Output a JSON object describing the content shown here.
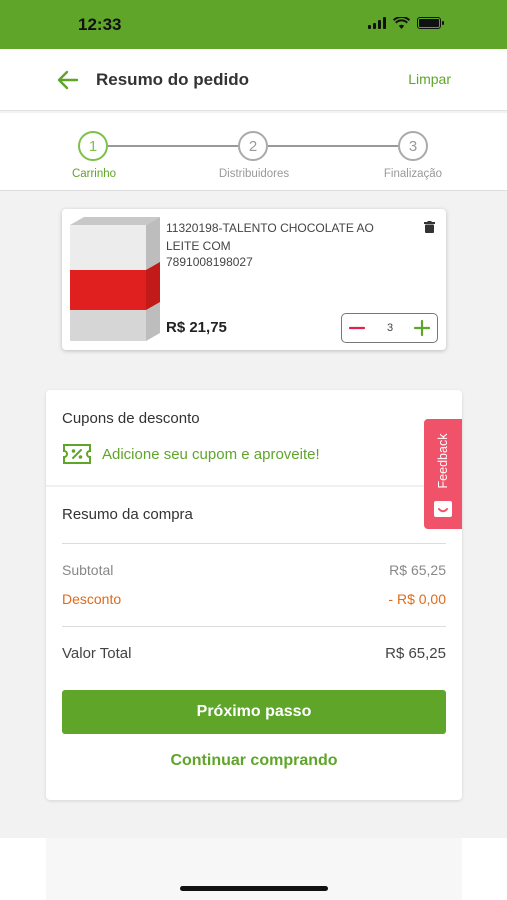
{
  "status_bar": {
    "time": "12:33"
  },
  "header": {
    "title": "Resumo do pedido",
    "clear_label": "Limpar"
  },
  "steps": [
    {
      "number": "1",
      "label": "Carrinho",
      "active": true
    },
    {
      "number": "2",
      "label": "Distribuidores",
      "active": false
    },
    {
      "number": "3",
      "label": "Finalização",
      "active": false
    }
  ],
  "product": {
    "name": "11320198-TALENTO CHOCOLATE AO LEITE COM",
    "code": "7891008198027",
    "price": "R$ 21,75",
    "quantity": "3"
  },
  "coupons": {
    "title": "Cupons de desconto",
    "cta": "Adicione seu cupom e aproveite!"
  },
  "summary": {
    "title": "Resumo da compra",
    "subtotal_label": "Subtotal",
    "subtotal_value": "R$ 65,25",
    "discount_label": "Desconto",
    "discount_value": "- R$ 0,00",
    "total_label": "Valor Total",
    "total_value": "R$ 65,25"
  },
  "actions": {
    "next_label": "Próximo passo",
    "continue_label": "Continuar comprando"
  },
  "feedback": {
    "label": "Feedback"
  },
  "colors": {
    "brand_green": "#5fa52a",
    "discount_orange": "#e06a1a",
    "feedback_pink": "#f0526a"
  }
}
